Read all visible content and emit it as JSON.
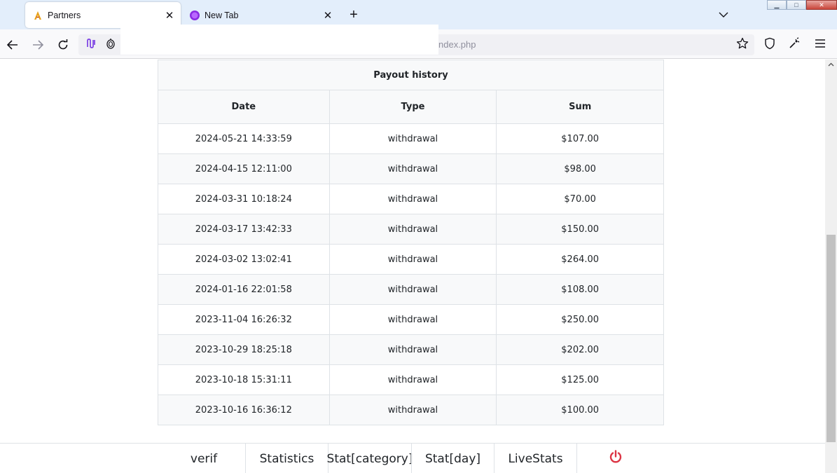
{
  "browser": {
    "tabs": [
      {
        "title": "Partners",
        "active": true,
        "favicon": "partners-logo-icon"
      },
      {
        "title": "New Tab",
        "active": false,
        "favicon": "private-browsing-icon"
      }
    ],
    "url_visible": "ndex.php"
  },
  "table": {
    "caption": "Payout history",
    "columns": [
      "Date",
      "Type",
      "Sum"
    ],
    "rows": [
      {
        "date": "2024-05-21 14:33:59",
        "type": "withdrawal",
        "sum": "$107.00"
      },
      {
        "date": "2024-04-15 12:11:00",
        "type": "withdrawal",
        "sum": "$98.00"
      },
      {
        "date": "2024-03-31 10:18:24",
        "type": "withdrawal",
        "sum": "$70.00"
      },
      {
        "date": "2024-03-17 13:42:33",
        "type": "withdrawal",
        "sum": "$150.00"
      },
      {
        "date": "2024-03-02 13:02:41",
        "type": "withdrawal",
        "sum": "$264.00"
      },
      {
        "date": "2024-01-16 22:01:58",
        "type": "withdrawal",
        "sum": "$108.00"
      },
      {
        "date": "2023-11-04 16:26:32",
        "type": "withdrawal",
        "sum": "$250.00"
      },
      {
        "date": "2023-10-29 18:25:18",
        "type": "withdrawal",
        "sum": "$202.00"
      },
      {
        "date": "2023-10-18 15:31:11",
        "type": "withdrawal",
        "sum": "$125.00"
      },
      {
        "date": "2023-10-16 16:36:12",
        "type": "withdrawal",
        "sum": "$100.00"
      }
    ]
  },
  "bottom_nav": {
    "items": [
      "verif",
      "Statistics",
      "Stat[category]",
      "Stat[day]",
      "LiveStats"
    ],
    "logout_icon": "power-icon",
    "logout_color": "#dc3545"
  }
}
